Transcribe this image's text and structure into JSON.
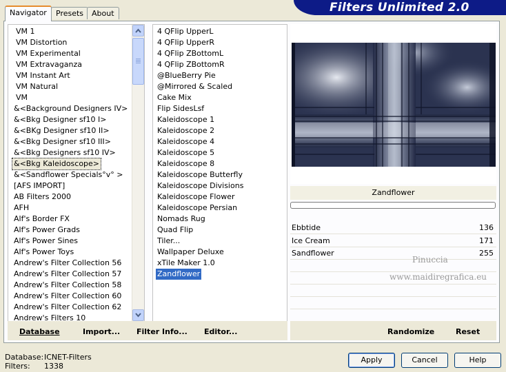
{
  "header": {
    "title": "Filters Unlimited 2.0"
  },
  "tabs": [
    {
      "label": "Navigator",
      "active": true
    },
    {
      "label": "Presets",
      "active": false
    },
    {
      "label": "About",
      "active": false
    }
  ],
  "categories": {
    "items": [
      "VM 1",
      "VM Distortion",
      "VM Experimental",
      "VM Extravaganza",
      "VM Instant Art",
      "VM Natural",
      "VM",
      "&<Background Designers IV>",
      "&<Bkg Designer sf10 I>",
      "&<BKg Designer sf10 II>",
      "&<Bkg Designer sf10 III>",
      "&<Bkg Designers sf10 IV>",
      "&<Bkg Kaleidoscope>",
      "&<Sandflower Specials°v° >",
      "[AFS IMPORT]",
      "AB Filters 2000",
      "AFH",
      "Alf's Border FX",
      "Alf's Power Grads",
      "Alf's Power Sines",
      "Alf's Power Toys",
      "Andrew's Filter Collection 56",
      "Andrew's Filter Collection 57",
      "Andrew's Filter Collection 58",
      "Andrew's Filter Collection 60",
      "Andrew's Filter Collection 62",
      "Andrew's Filters 10"
    ],
    "focused_index": 12
  },
  "filters": {
    "items": [
      "4 QFlip UpperL",
      "4 QFlip UpperR",
      "4 QFlip ZBottomL",
      "4 QFlip ZBottomR",
      "@BlueBerry Pie",
      "@Mirrored & Scaled",
      "Cake Mix",
      "Flip SidesLsf",
      "Kaleidoscope 1",
      "Kaleidoscope 2",
      "Kaleidoscope 4",
      "Kaleidoscope 5",
      "Kaleidoscope 8",
      "Kaleidoscope Butterfly",
      "Kaleidoscope Divisions",
      "Kaleidoscope Flower",
      "Kaleidoscope Persian",
      "Nomads Rug",
      "Quad Flip",
      "Tiler...",
      "Wallpaper Deluxe",
      "xTile Maker 1.0",
      "Zandflower"
    ],
    "selected_index": 22
  },
  "selected_filter": {
    "name": "Zandflower"
  },
  "params": [
    {
      "name": "Ebbtide",
      "value": "136"
    },
    {
      "name": "Ice Cream",
      "value": "171"
    },
    {
      "name": "Sandflower",
      "value": "255"
    }
  ],
  "watermark": {
    "line1": "Pinuccia",
    "line2": "www.maidiregrafica.eu"
  },
  "left_toolbar": {
    "database": "Database",
    "import": "Import...",
    "filter_info": "Filter Info...",
    "editor": "Editor..."
  },
  "right_toolbar": {
    "randomize": "Randomize",
    "reset": "Reset"
  },
  "status": {
    "database_label": "Database:",
    "database_value": "ICNET-Filters",
    "filters_label": "Filters:",
    "filters_value": "1338"
  },
  "buttons": {
    "apply": "Apply",
    "cancel": "Cancel",
    "help": "Help"
  },
  "colors": {
    "banner": "#0d1b87",
    "selection": "#316ac5",
    "tab_highlight": "#e68b2c"
  }
}
